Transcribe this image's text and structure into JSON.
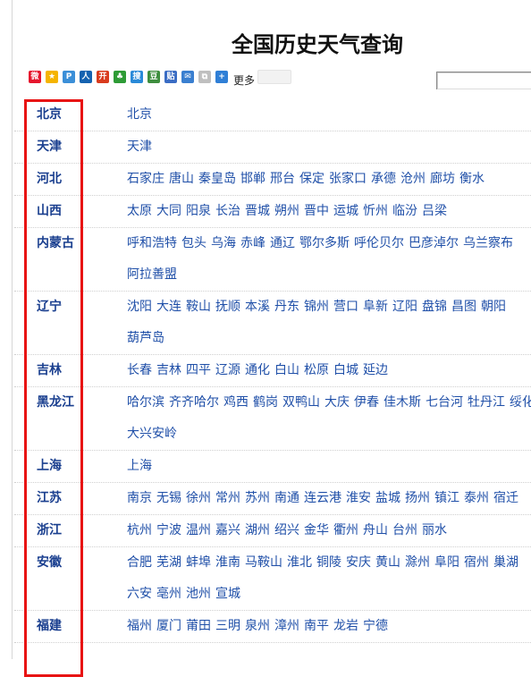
{
  "title": "全国历史天气查询",
  "share": {
    "more_label": "更多",
    "icons": [
      {
        "name": "sina-weibo-icon",
        "color": "#e6162d",
        "glyph": "微"
      },
      {
        "name": "qzone-icon",
        "color": "#f5b400",
        "glyph": "★"
      },
      {
        "name": "tencent-weibo-icon",
        "color": "#3b8fd8",
        "glyph": "P"
      },
      {
        "name": "renren-icon",
        "color": "#1562b0",
        "glyph": "人"
      },
      {
        "name": "kaixin-icon",
        "color": "#d93b1e",
        "glyph": "开"
      },
      {
        "name": "clover-icon",
        "color": "#2e9b36",
        "glyph": "♣"
      },
      {
        "name": "sohu-icon",
        "color": "#2a8ad8",
        "glyph": "搜"
      },
      {
        "name": "douban-icon",
        "color": "#3e8e3e",
        "glyph": "豆"
      },
      {
        "name": "tieba-icon",
        "color": "#3a6cc4",
        "glyph": "贴"
      },
      {
        "name": "email-icon",
        "color": "#3a7fd0",
        "glyph": "✉"
      },
      {
        "name": "copy-icon",
        "color": "#bfbfbf",
        "glyph": "⧉"
      },
      {
        "name": "more-plus-icon",
        "color": "#2f7fd6",
        "glyph": "+"
      }
    ]
  },
  "provinces": [
    {
      "name": "北京",
      "cities": [
        "北京"
      ]
    },
    {
      "name": "天津",
      "cities": [
        "天津"
      ]
    },
    {
      "name": "河北",
      "cities": [
        "石家庄",
        "唐山",
        "秦皇岛",
        "邯郸",
        "邢台",
        "保定",
        "张家口",
        "承德",
        "沧州",
        "廊坊",
        "衡水"
      ]
    },
    {
      "name": "山西",
      "cities": [
        "太原",
        "大同",
        "阳泉",
        "长治",
        "晋城",
        "朔州",
        "晋中",
        "运城",
        "忻州",
        "临汾",
        "吕梁"
      ]
    },
    {
      "name": "内蒙古",
      "cities": [
        "呼和浩特",
        "包头",
        "乌海",
        "赤峰",
        "通辽",
        "鄂尔多斯",
        "呼伦贝尔",
        "巴彦淖尔",
        "乌兰察布",
        "阿拉善盟"
      ]
    },
    {
      "name": "辽宁",
      "cities": [
        "沈阳",
        "大连",
        "鞍山",
        "抚顺",
        "本溪",
        "丹东",
        "锦州",
        "营口",
        "阜新",
        "辽阳",
        "盘锦",
        "昌图",
        "朝阳",
        "葫芦岛"
      ]
    },
    {
      "name": "吉林",
      "cities": [
        "长春",
        "吉林",
        "四平",
        "辽源",
        "通化",
        "白山",
        "松原",
        "白城",
        "延边"
      ]
    },
    {
      "name": "黑龙江",
      "cities": [
        "哈尔滨",
        "齐齐哈尔",
        "鸡西",
        "鹤岗",
        "双鸭山",
        "大庆",
        "伊春",
        "佳木斯",
        "七台河",
        "牡丹江",
        "绥化",
        "大兴安岭"
      ]
    },
    {
      "name": "上海",
      "cities": [
        "上海"
      ]
    },
    {
      "name": "江苏",
      "cities": [
        "南京",
        "无锡",
        "徐州",
        "常州",
        "苏州",
        "南通",
        "连云港",
        "淮安",
        "盐城",
        "扬州",
        "镇江",
        "泰州",
        "宿迁"
      ]
    },
    {
      "name": "浙江",
      "cities": [
        "杭州",
        "宁波",
        "温州",
        "嘉兴",
        "湖州",
        "绍兴",
        "金华",
        "衢州",
        "舟山",
        "台州",
        "丽水"
      ]
    },
    {
      "name": "安徽",
      "cities": [
        "合肥",
        "芜湖",
        "蚌埠",
        "淮南",
        "马鞍山",
        "淮北",
        "铜陵",
        "安庆",
        "黄山",
        "滁州",
        "阜阳",
        "宿州",
        "巢湖",
        "六安",
        "亳州",
        "池州",
        "宣城"
      ]
    },
    {
      "name": "福建",
      "cities": [
        "福州",
        "厦门",
        "莆田",
        "三明",
        "泉州",
        "漳州",
        "南平",
        "龙岩",
        "宁德"
      ]
    }
  ]
}
